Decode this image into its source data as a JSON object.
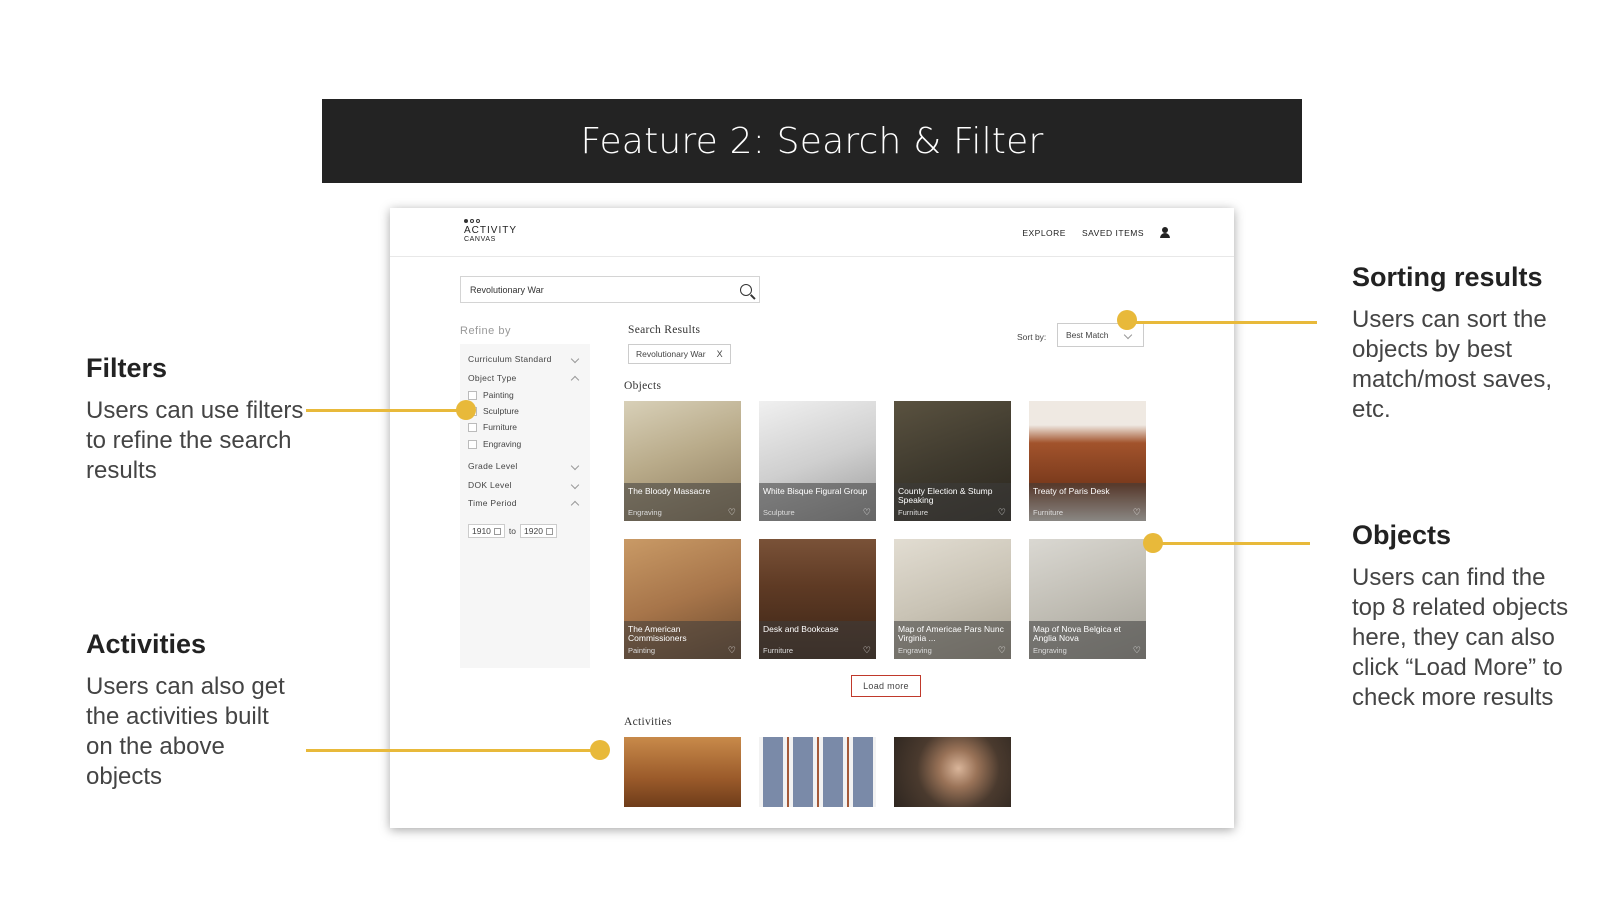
{
  "slide": {
    "title": "Feature 2: Search & Filter"
  },
  "annotations": {
    "filters": {
      "title": "Filters",
      "body": "Users can use filters to refine the search results"
    },
    "activities": {
      "title": "Activities",
      "body": "Users can also get the activities built on the above objects"
    },
    "sorting": {
      "title": "Sorting results",
      "body": "Users can sort the objects by best match/most saves, etc."
    },
    "objects": {
      "title": "Objects",
      "body": "Users can find the top 8 related objects here, they can also click “Load More” to check more results"
    }
  },
  "colors": {
    "accent": "#e8b93a",
    "title_bar": "#232323",
    "load_more_border": "#c0392b"
  },
  "app": {
    "logo": {
      "line1": "ACTIVITY",
      "line2": "CANVAS"
    },
    "nav": {
      "explore": "EXPLORE",
      "saved": "SAVED ITEMS",
      "user_icon": "user-icon"
    },
    "search": {
      "value": "Revolutionary War",
      "icon": "search-icon"
    },
    "refine": {
      "label": "Refine by",
      "curriculum": "Curriculum Standard",
      "object_type": "Object Type",
      "options": [
        "Painting",
        "Sculpture",
        "Furniture",
        "Engraving"
      ],
      "grade": "Grade Level",
      "dok": "DOK Level",
      "time_period": "Time Period",
      "from": "1910",
      "to_label": "to",
      "to": "1920"
    },
    "results": {
      "title": "Search Results",
      "chip": "Revolutionary War",
      "chip_close": "X",
      "sort_label": "Sort by:",
      "sort_value": "Best Match"
    },
    "objects_label": "Objects",
    "objects": [
      {
        "name": "The Bloody Massacre",
        "type": "Engraving"
      },
      {
        "name": "White Bisque Figural Group",
        "type": "Sculpture"
      },
      {
        "name": "County Election & Stump Speaking",
        "type": "Furniture"
      },
      {
        "name": "Treaty of Paris Desk",
        "type": "Furniture"
      },
      {
        "name": "The American Commissioners",
        "type": "Painting"
      },
      {
        "name": "Desk and Bookcase",
        "type": "Furniture"
      },
      {
        "name": "Map of Americae Pars Nunc Virginia ...",
        "type": "Engraving"
      },
      {
        "name": "Map of Nova Belgica et Anglia Nova",
        "type": "Engraving"
      }
    ],
    "load_more": "Load more",
    "activities_label": "Activities"
  }
}
